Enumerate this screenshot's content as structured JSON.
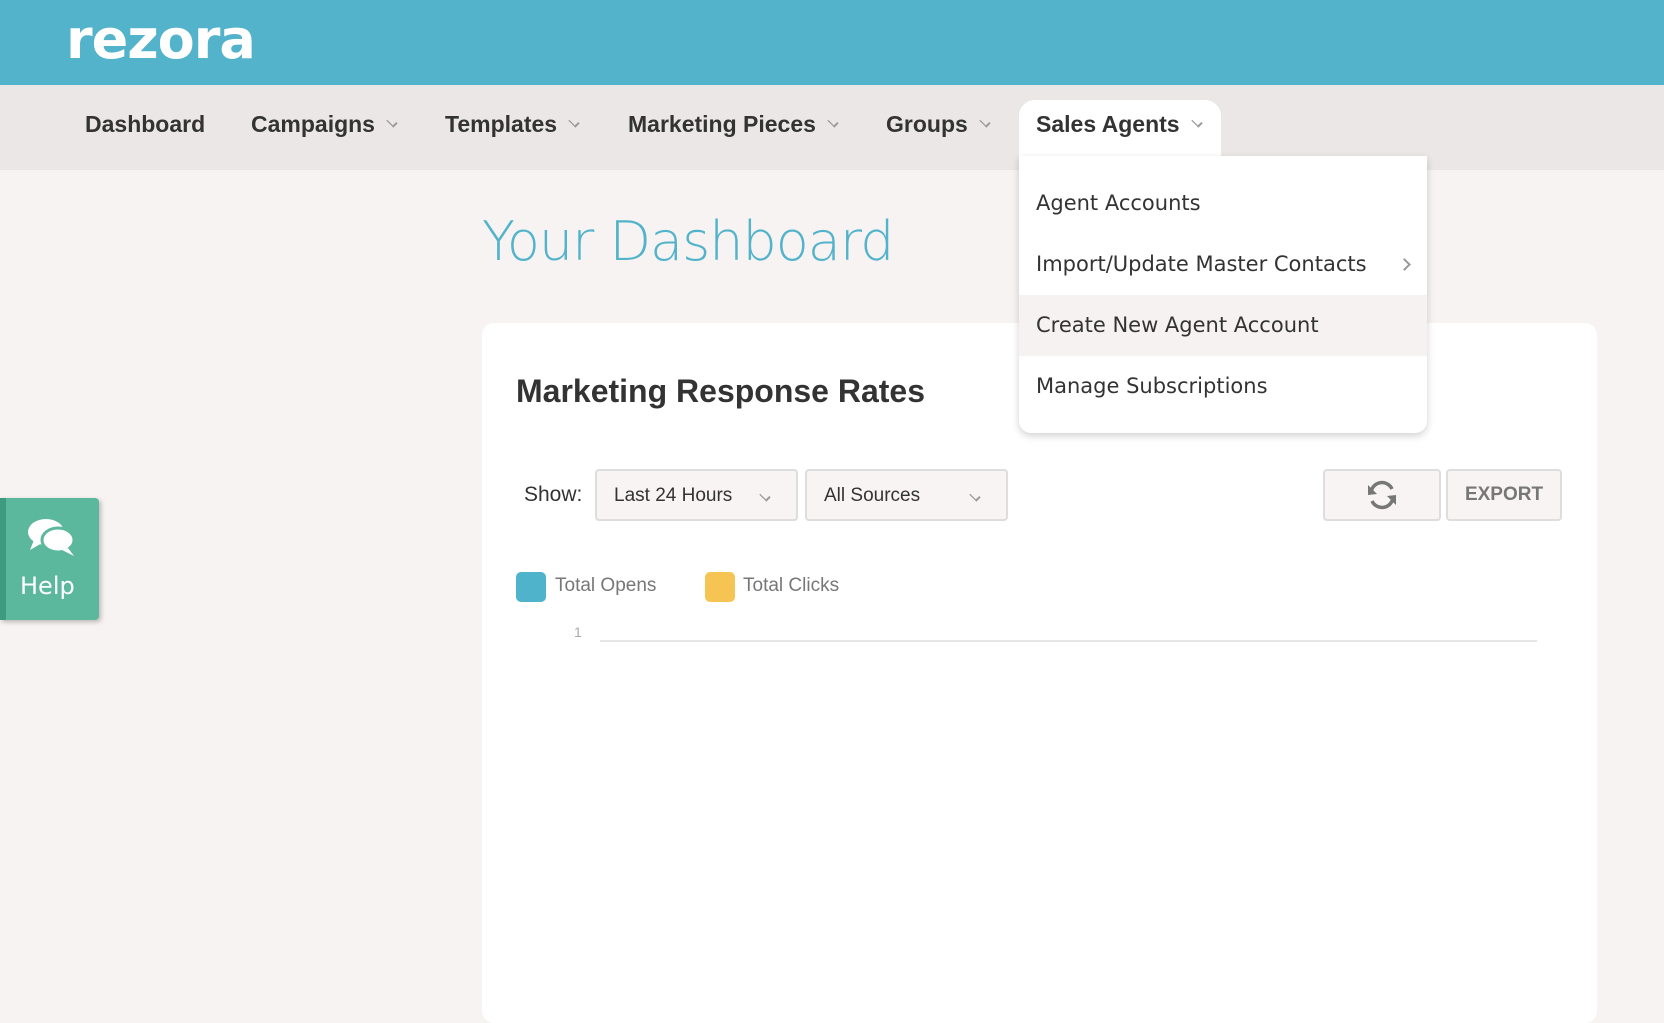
{
  "brand": {
    "logo": "rezora",
    "header_color": "#52b3cb",
    "accent": "#52b3cb"
  },
  "nav": {
    "items": [
      {
        "label": "Dashboard",
        "dropdown": false
      },
      {
        "label": "Campaigns",
        "dropdown": true
      },
      {
        "label": "Templates",
        "dropdown": true
      },
      {
        "label": "Marketing Pieces",
        "dropdown": true
      },
      {
        "label": "Groups",
        "dropdown": true
      },
      {
        "label": "Sales Agents",
        "dropdown": true,
        "active": true
      }
    ]
  },
  "sales_agents_menu": {
    "items": [
      {
        "label": "Agent Accounts"
      },
      {
        "label": "Import/Update Master Contacts",
        "submenu": true
      },
      {
        "label": "Create New Agent Account",
        "hovered": true
      },
      {
        "label": "Manage Subscriptions"
      }
    ]
  },
  "page": {
    "title": "Your Dashboard"
  },
  "card": {
    "title": "Marketing Response Rates",
    "show_label": "Show:",
    "time_filter": "Last 24 Hours",
    "source_filter": "All Sources",
    "refresh_icon": "refresh-icon",
    "export_label": "EXPORT"
  },
  "chart_data": {
    "type": "line",
    "series": [
      {
        "name": "Total Opens",
        "color": "#4fb3cb",
        "values": []
      },
      {
        "name": "Total Clicks",
        "color": "#f6c453",
        "values": []
      }
    ],
    "y_ticks": [
      "1"
    ],
    "legend": "top-left"
  },
  "help": {
    "label": "Help",
    "icon": "chat-bubbles-icon",
    "color": "#5cb89d"
  }
}
